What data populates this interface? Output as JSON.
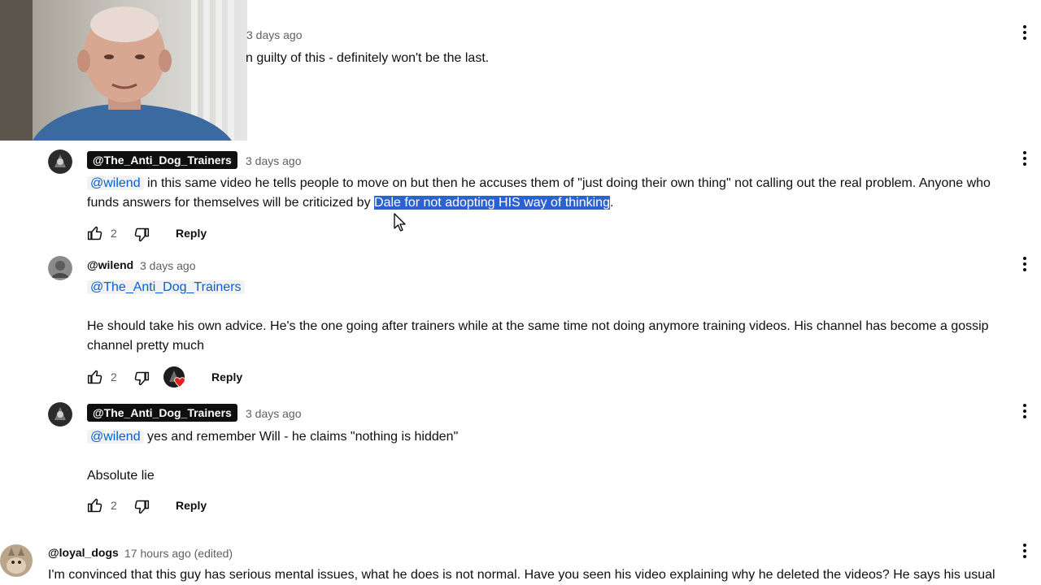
{
  "webcam": {
    "label": ""
  },
  "comment0": {
    "time": "3 days ago",
    "text": "n guilty of this - definitely won't be the last."
  },
  "comment1": {
    "author": "@The_Anti_Dog_Trainers",
    "time": "3 days ago",
    "mention": "@wilend",
    "line1": " in this same video he tells people to move on but then he accuses them of \"just doing their own thing\" not calling out the real problem.  Anyone who",
    "line2_pre": "funds answers for themselves will be criticized by ",
    "line2_sel": "Dale for not adopting HIS way of thinking",
    "line2_post": ".",
    "likes": "2",
    "reply": "Reply"
  },
  "comment2": {
    "author": "@wilend",
    "time": "3 days ago",
    "mention": "@The_Anti_Dog_Trainers",
    "line1": "He should take his own advice. He's the one going after trainers while at the same time not doing anymore training videos. His channel has become a gossip",
    "line2": "channel pretty much",
    "likes": "2",
    "reply": "Reply"
  },
  "comment3": {
    "author": "@The_Anti_Dog_Trainers",
    "time": "3 days ago",
    "mention": "@wilend",
    "line1": " yes and remember Will - he claims \"nothing is hidden\"",
    "line2": "Absolute lie",
    "likes": "2",
    "reply": "Reply"
  },
  "comment4": {
    "author": "@loyal_dogs",
    "time": "17 hours ago (edited)",
    "line1": "I'm convinced that this guy has serious mental issues, what he does is not normal. Have you seen his video explaining why he deleted the videos? He says his usual"
  },
  "colors": {
    "link": "#065fd4",
    "selection": "#2b61d1",
    "chip": "#0f0f0f",
    "muted": "#606060",
    "heart": "#e62117"
  },
  "icons": [
    "thumb-up-icon",
    "thumb-down-icon",
    "more-vert-icon",
    "cursor-icon",
    "heart-icon"
  ]
}
